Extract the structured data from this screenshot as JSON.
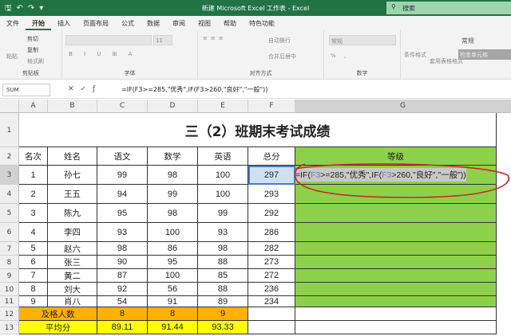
{
  "titlebar": {
    "title": "新建 Microsoft Excel 工作表  -  Excel",
    "search": "搜索"
  },
  "menu": [
    "文件",
    "开始",
    "插入",
    "页面布局",
    "公式",
    "数据",
    "审阅",
    "视图",
    "帮助",
    "特色功能"
  ],
  "ribbon": {
    "paste": "粘贴",
    "cut": "剪切",
    "copy": "复制",
    "format_painter": "格式刷",
    "clipboard": "剪贴板",
    "font_size": "11",
    "font": "字体",
    "wrap": "自动换行",
    "merge": "合并后居中",
    "alignment": "对齐方式",
    "number_format": "常规",
    "number": "数字",
    "cond_format": "条件格式",
    "table_format": "套用表格格式",
    "style_normal": "常规",
    "style_check": "检查单元格"
  },
  "formula_bar": {
    "name_box": "SUM",
    "formula": "=IF(F3>=285,\"优秀\",IF(F3>260,\"良好\",\"一般\"))"
  },
  "columns": [
    "A",
    "B",
    "C",
    "D",
    "E",
    "F",
    "G"
  ],
  "rows": [
    "1",
    "2",
    "3",
    "4",
    "5",
    "6",
    "7",
    "8",
    "9",
    "10",
    "11",
    "12",
    "13"
  ],
  "sheet": {
    "title": "三（2）班期末考试成绩",
    "headers": [
      "名次",
      "姓名",
      "语文",
      "数学",
      "英语",
      "总分",
      "等级"
    ],
    "data": [
      [
        "1",
        "孙七",
        "99",
        "98",
        "100",
        "297"
      ],
      [
        "2",
        "王五",
        "94",
        "99",
        "100",
        "293"
      ],
      [
        "3",
        "陈九",
        "95",
        "98",
        "99",
        "292"
      ],
      [
        "4",
        "李四",
        "93",
        "100",
        "93",
        "286"
      ],
      [
        "5",
        "赵六",
        "98",
        "86",
        "98",
        "282"
      ],
      [
        "6",
        "张三",
        "90",
        "95",
        "88",
        "273"
      ],
      [
        "7",
        "黄二",
        "87",
        "100",
        "85",
        "272"
      ],
      [
        "8",
        "刘大",
        "92",
        "56",
        "88",
        "236"
      ],
      [
        "9",
        "肖八",
        "54",
        "91",
        "89",
        "234"
      ]
    ],
    "pass_label": "及格人数",
    "pass": [
      "8",
      "8",
      "9"
    ],
    "avg_label": "平均分",
    "avg": [
      "89.11",
      "91.44",
      "93.33"
    ],
    "editing": {
      "p1": "=IF(",
      "ref1": "F3",
      "p2": ">=285,\"优秀\",IF(",
      "ref2": "F3",
      "p3": ">260,\"良好\",\"一般\"))"
    }
  },
  "colors": {
    "green": "#8dd14b",
    "orange": "#ffb100",
    "yellow": "#ffff00",
    "excel": "#217346"
  }
}
